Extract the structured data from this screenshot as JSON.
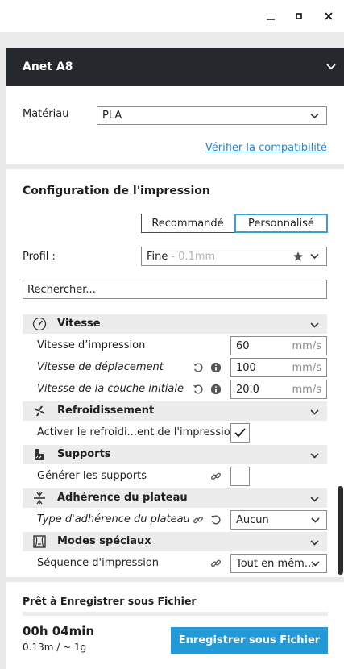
{
  "window": {
    "minimize_icon": "minimize-icon",
    "maximize_icon": "maximize-icon",
    "close_icon": "close-icon"
  },
  "printer": {
    "name": "Anet A8"
  },
  "material": {
    "label": "Matériau",
    "value": "PLA",
    "compat_link": "Vérifier la compatibilité"
  },
  "config": {
    "title": "Configuration de l'impression",
    "mode_recommended": "Recommandé",
    "mode_custom": "Personnalisé",
    "profile_label": "Profil :",
    "profile_value": "Fine",
    "profile_sub": "- 0.1mm",
    "search_placeholder": "Rechercher..."
  },
  "categories": {
    "speed": {
      "label": "Vitesse",
      "print_speed": {
        "label": "Vitesse d’impression",
        "value": "60",
        "unit": "mm/s"
      },
      "travel_speed": {
        "label": "Vitesse de déplacement",
        "value": "100",
        "unit": "mm/s"
      },
      "initial_layer_speed": {
        "label": "Vitesse de la couche initiale",
        "value": "20.0",
        "unit": "mm/s"
      }
    },
    "cooling": {
      "label": "Refroidissement",
      "enable_cooling": {
        "label": "Activer le refroidi...ent de l'impression",
        "checked": true
      }
    },
    "supports": {
      "label": "Supports",
      "generate_supports": {
        "label": "Générer les supports",
        "checked": false
      }
    },
    "adhesion": {
      "label": "Adhérence du plateau",
      "adhesion_type": {
        "label": "Type d'adhérence du plateau",
        "value": "Aucun"
      }
    },
    "special": {
      "label": "Modes spéciaux",
      "print_sequence": {
        "label": "Séquence d'impression",
        "value": "Tout en mêm..."
      }
    }
  },
  "output": {
    "title": "Prêt à Enregistrer sous Fichier",
    "time": "00h 04min",
    "material": "0.13m / ~ 1g",
    "save_button": "Enregistrer sous Fichier"
  },
  "colors": {
    "accent": "#2399d8",
    "header_bg": "#25282c",
    "link": "#2d87c8"
  }
}
